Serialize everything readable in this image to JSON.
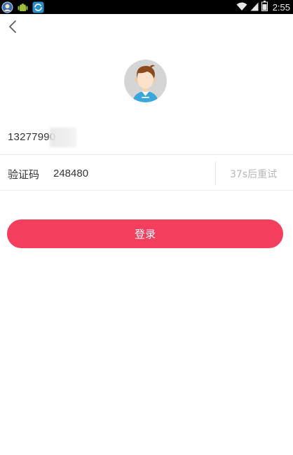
{
  "status_bar": {
    "time": "2:55",
    "icons": [
      "notification-app-icon",
      "android-debug-icon",
      "sync-app-icon",
      "wifi-icon",
      "signal-icon",
      "battery-icon"
    ]
  },
  "form": {
    "phone_value": "13277990",
    "code_label": "验证码",
    "code_value": "248480",
    "resend_label": "37s后重试"
  },
  "login_label": "登录",
  "colors": {
    "accent": "#f43e5e",
    "divider": "#ececec",
    "muted_text": "#b8b8b8"
  }
}
